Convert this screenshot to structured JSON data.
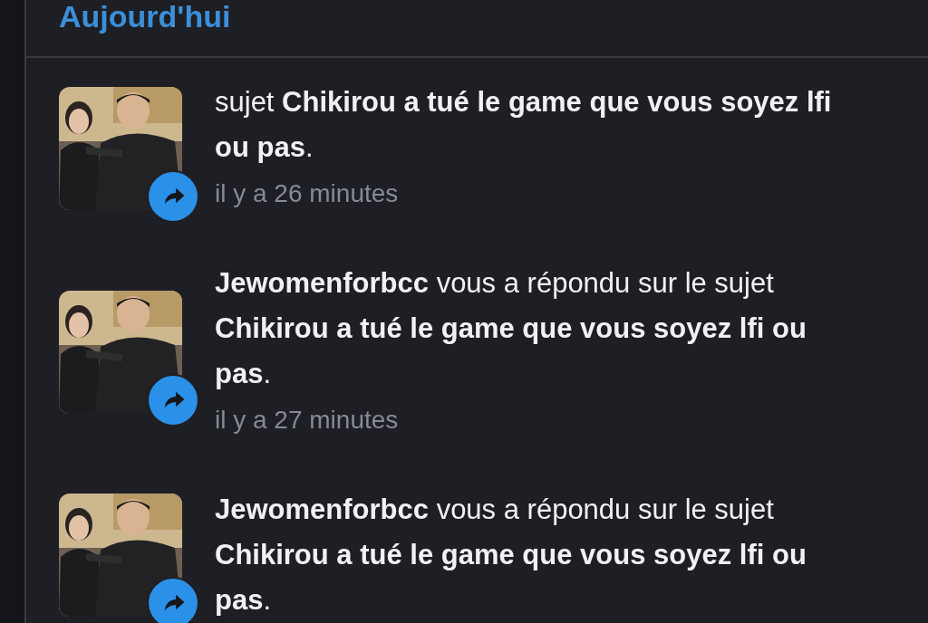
{
  "section": {
    "title": "Aujourd'hui"
  },
  "notifications": [
    {
      "text": "sujet **Chikirou a tué le game que vous soyez lfi ou pas**.",
      "time": "il y a 26 minutes"
    },
    {
      "text": "**Jewomenforbcc** vous a répondu sur le sujet **Chikirou a tué le game que vous soyez lfi ou pas**.",
      "time": "il y a 27 minutes"
    },
    {
      "text": "**Jewomenforbcc** vous a répondu sur le sujet **Chikirou a tué le game que vous soyez lfi ou pas**."
    }
  ]
}
